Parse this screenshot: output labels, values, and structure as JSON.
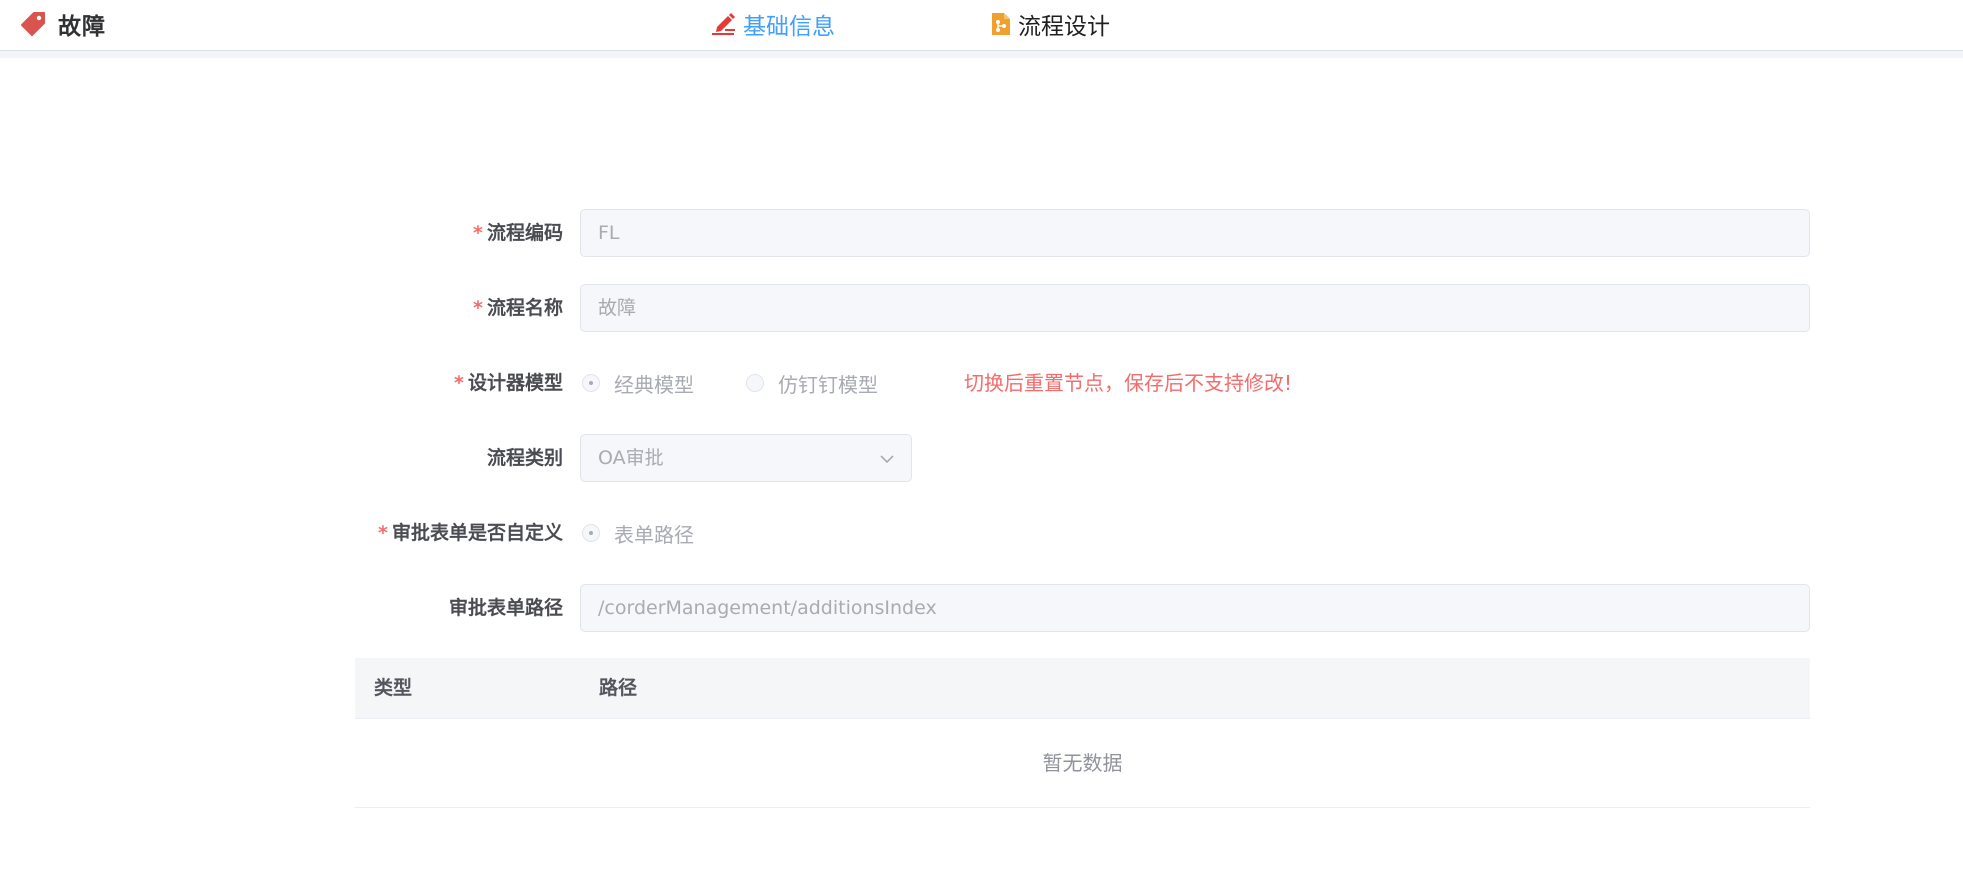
{
  "header": {
    "title": "故障",
    "tabs": [
      {
        "label": "基础信息",
        "icon": "edit-pen-icon",
        "active": true
      },
      {
        "label": "流程设计",
        "icon": "flow-document-icon",
        "active": false
      }
    ]
  },
  "form": {
    "required_mark": "*",
    "code": {
      "label": "流程编码",
      "value": "FL"
    },
    "name": {
      "label": "流程名称",
      "value": "故障"
    },
    "designer_model": {
      "label": "设计器模型",
      "options": [
        "经典模型",
        "仿钉钉模型"
      ],
      "selected": "经典模型",
      "warning": "切换后重置节点，保存后不支持修改!"
    },
    "category": {
      "label": "流程类别",
      "value": "OA审批"
    },
    "custom_form": {
      "label": "审批表单是否自定义",
      "option": "表单路径",
      "selected": "表单路径"
    },
    "form_path": {
      "label": "审批表单路径",
      "value": "/corderManagement/additionsIndex"
    }
  },
  "table": {
    "columns": [
      "类型",
      "路径"
    ],
    "rows": [],
    "empty_text": "暂无数据"
  },
  "colors": {
    "accent": "#409eff",
    "danger": "#f56c6c",
    "disabled_text": "#a8abb2",
    "tag_icon": "#d9534f",
    "flow_icon": "#f0a030"
  }
}
